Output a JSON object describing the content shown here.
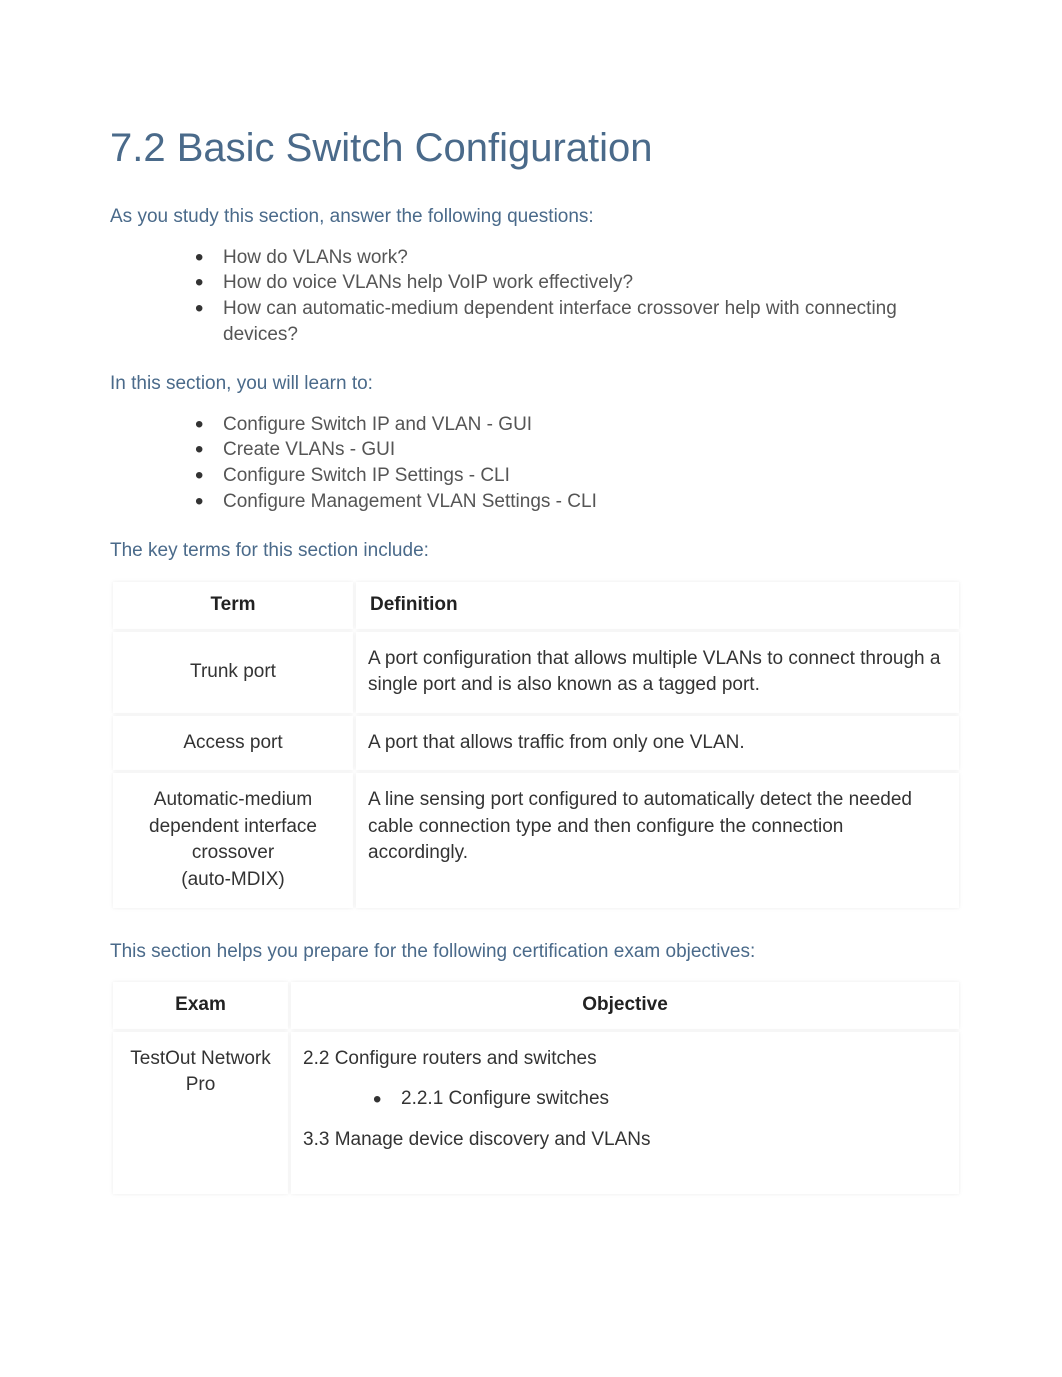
{
  "title": "7.2 Basic Switch Configuration",
  "intro": "As you study this section, answer the following questions:",
  "questions": [
    "How do VLANs work?",
    "How do voice VLANs help VoIP work effectively?",
    "How can automatic-medium dependent interface crossover help with connecting devices?"
  ],
  "learn_intro": "In this section, you will learn to:",
  "learn_items": [
    "Configure Switch IP and VLAN - GUI",
    "Create VLANs - GUI",
    "Configure Switch IP Settings - CLI",
    "Configure Management VLAN Settings - CLI"
  ],
  "terms_intro": "The key terms for this section include:",
  "terms_table": {
    "head_term": "Term",
    "head_def": "Definition",
    "rows": [
      {
        "term": "Trunk port",
        "def": "A port configuration that allows multiple VLANs to connect through a single port and is also known as a tagged port."
      },
      {
        "term": "Access port",
        "def": "A port that allows traffic from only one VLAN."
      },
      {
        "term": "Automatic-medium dependent interface crossover\n(auto-MDIX)",
        "def": "A line sensing port configured to automatically detect the needed cable connection type and then configure the connection accordingly."
      }
    ]
  },
  "cert_intro": "This section helps you prepare for the following certification exam objectives:",
  "cert_table": {
    "head_exam": "Exam",
    "head_obj": "Objective",
    "exam_name": "TestOut Network Pro",
    "obj": {
      "line1": "2.2 Configure routers and switches",
      "sub1": "2.2.1 Configure switches",
      "line2": "3.3 Manage device discovery and VLANs"
    }
  }
}
